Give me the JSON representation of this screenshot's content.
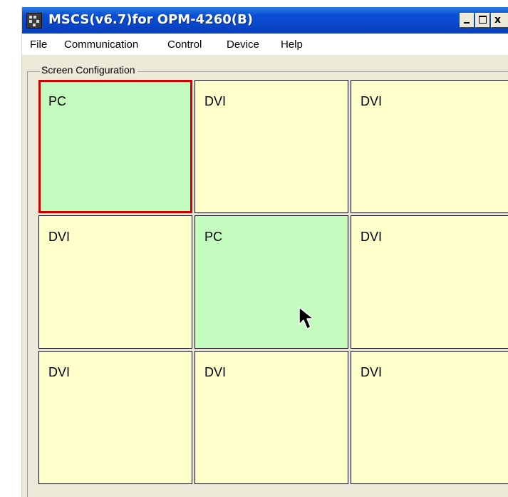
{
  "window": {
    "title": "MSCS(v6.7)for OPM-4260(B)",
    "close_glyph": "x"
  },
  "menu": [
    "File",
    "Communication",
    "Control",
    "Device",
    "Help"
  ],
  "group": {
    "label": "Screen Configuration"
  },
  "grid": {
    "rows": 3,
    "cols": 3,
    "cells": [
      {
        "label": "PC",
        "type": "pc",
        "selected": true
      },
      {
        "label": "DVI",
        "type": "dvi",
        "selected": false
      },
      {
        "label": "DVI",
        "type": "dvi",
        "selected": false
      },
      {
        "label": "DVI",
        "type": "dvi",
        "selected": false
      },
      {
        "label": "PC",
        "type": "pc",
        "selected": false
      },
      {
        "label": "DVI",
        "type": "dvi",
        "selected": false
      },
      {
        "label": "DVI",
        "type": "dvi",
        "selected": false
      },
      {
        "label": "DVI",
        "type": "dvi",
        "selected": false
      },
      {
        "label": "DVI",
        "type": "dvi",
        "selected": false
      }
    ]
  },
  "colors": {
    "pc_cell": "#c4fcc0",
    "dvi_cell": "#ffffcc",
    "selected_border": "#cc0000",
    "title_bar": "#0a4fd6"
  },
  "icons": [
    "app-icon",
    "minimize-icon",
    "maximize-icon",
    "close-icon",
    "mouse-pointer-icon"
  ]
}
